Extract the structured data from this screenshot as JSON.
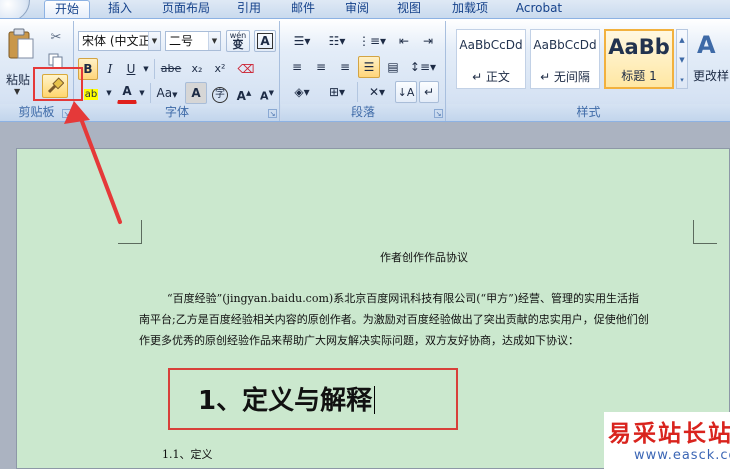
{
  "tabs": [
    {
      "label": "开始",
      "active": true
    },
    {
      "label": "插入",
      "active": false
    },
    {
      "label": "页面布局",
      "active": false
    },
    {
      "label": "引用",
      "active": false
    },
    {
      "label": "邮件",
      "active": false
    },
    {
      "label": "审阅",
      "active": false
    },
    {
      "label": "视图",
      "active": false
    },
    {
      "label": "加载项",
      "active": false
    },
    {
      "label": "Acrobat",
      "active": false
    }
  ],
  "clipboard": {
    "paste_label": "粘贴",
    "group_label": "剪贴板"
  },
  "font": {
    "font_name": "宋体 (中文正文",
    "font_size": "二号",
    "wen_label": "wén",
    "group_label": "字体",
    "bold": "B",
    "italic": "I",
    "underline": "U",
    "strike": "abe",
    "sub": "x₂",
    "sup": "x²",
    "case": "Aa",
    "highlight": "ab",
    "shade": "A",
    "grow": "A",
    "shrink": "A"
  },
  "paragraph": {
    "group_label": "段落"
  },
  "styles": {
    "group_label": "样式",
    "items": [
      {
        "sample": "AaBbCcDd",
        "name": "↵ 正文"
      },
      {
        "sample": "AaBbCcDd",
        "name": "↵ 无间隔"
      },
      {
        "sample": "AaBb",
        "name": "标题 1"
      }
    ],
    "change_label": "更改样"
  },
  "document": {
    "title": "作者创作作品协议",
    "para_lines": [
      "“百度经验”(jingyan.baidu.com)系北京百度网讯科技有限公司(“甲方”)经营、管理的实用生活指",
      "南平台;乙方是百度经验相关内容的原创作者。为激励对百度经验做出了突出贡献的忠实用户，促使他们创",
      "作更多优秀的原创经验作品来帮助广大网友解决实际问题，双方友好协商，达成如下协议："
    ],
    "heading": "1、定义与解释",
    "sub_item": "1.1、定义"
  },
  "watermark": {
    "cn": "易采站长站",
    "url": "www.easck.com"
  },
  "colors": {
    "font_color": "#e0201c",
    "highlight_color": "#ffff00",
    "annotation": "#e53939",
    "page_bg": "#cbe8ce"
  }
}
